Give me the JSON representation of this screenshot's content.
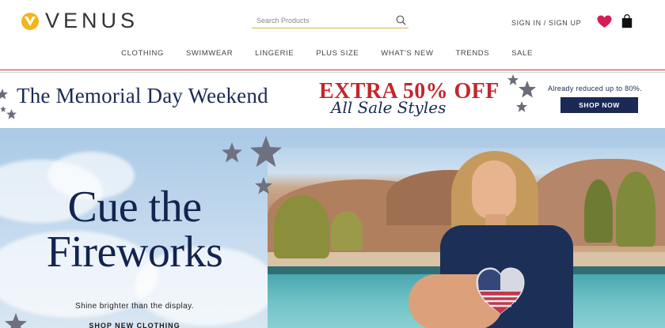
{
  "brand": {
    "logo_text": "VENUS",
    "accent_color": "#f2b51d",
    "navy_color": "#1a2a55",
    "red_color": "#c1272d"
  },
  "header": {
    "search_placeholder": "Search Products",
    "signin_label": "SIGN IN / SIGN UP",
    "wishlist_icon": "heart-icon",
    "bag_icon": "shopping-bag-icon"
  },
  "nav": {
    "items": [
      "CLOTHING",
      "SWIMWEAR",
      "LINGERIE",
      "PLUS SIZE",
      "WHAT'S NEW",
      "TRENDS",
      "SALE"
    ]
  },
  "promo": {
    "title": "The Memorial Day Weekend",
    "extra": "EXTRA 50% OFF",
    "sub": "All Sale Styles",
    "note": "Already reduced up to 80%.",
    "cta": "SHOP NOW"
  },
  "hero": {
    "title": "Cue the Fireworks",
    "subtitle": "Shine brighter than the display.",
    "cta": "SHOP NEW CLOTHING"
  }
}
